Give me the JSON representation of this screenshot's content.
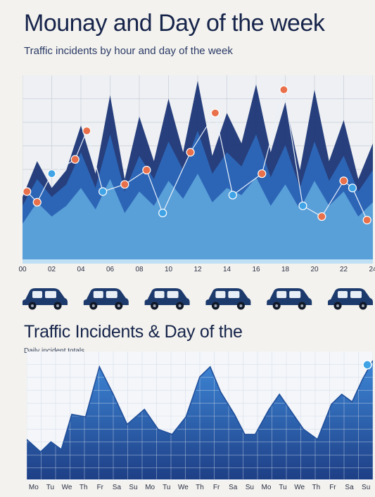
{
  "title": "Mounay and Day of the week",
  "subtitle": "Traffic incidents by hour and day of the week",
  "chart_data": [
    {
      "type": "area",
      "title": "Mounay and Day of the week",
      "subtitle": "Traffic incidents by hour and day of the week",
      "x_tick_labels": [
        "00",
        "02",
        "04",
        "06",
        "08",
        "10",
        "12",
        "14",
        "16",
        "18",
        "20",
        "22",
        "24"
      ],
      "ylim": [
        0,
        100
      ],
      "peak_series": [
        {
          "name": "",
          "color": "#1b3576",
          "values": [
            35,
            55,
            40,
            50,
            75,
            48,
            92,
            45,
            80,
            55,
            90,
            60,
            100,
            58,
            82,
            65,
            98,
            60,
            88,
            50,
            95,
            55,
            78,
            45,
            65
          ]
        },
        {
          "name": "",
          "color": "#2e6cc0",
          "values": [
            30,
            45,
            35,
            42,
            60,
            40,
            70,
            38,
            58,
            45,
            66,
            50,
            72,
            48,
            60,
            52,
            70,
            46,
            64,
            40,
            66,
            44,
            58,
            38,
            50
          ]
        },
        {
          "name": "",
          "color": "#62a9de",
          "values": [
            20,
            32,
            24,
            30,
            40,
            28,
            45,
            26,
            38,
            30,
            44,
            34,
            48,
            32,
            40,
            36,
            46,
            30,
            42,
            28,
            44,
            30,
            38,
            24,
            32
          ]
        }
      ],
      "markers": {
        "points": [
          {
            "x": 0.3,
            "y": 38
          },
          {
            "x": 1.0,
            "y": 32
          },
          {
            "x": 2.0,
            "y": 48
          },
          {
            "x": 3.6,
            "y": 56
          },
          {
            "x": 4.4,
            "y": 72
          },
          {
            "x": 5.5,
            "y": 38
          },
          {
            "x": 7.0,
            "y": 42
          },
          {
            "x": 8.5,
            "y": 50
          },
          {
            "x": 9.6,
            "y": 26
          },
          {
            "x": 11.5,
            "y": 60
          },
          {
            "x": 13.2,
            "y": 82
          },
          {
            "x": 14.4,
            "y": 36
          },
          {
            "x": 16.4,
            "y": 48
          },
          {
            "x": 17.9,
            "y": 95
          },
          {
            "x": 19.2,
            "y": 30
          },
          {
            "x": 20.5,
            "y": 24
          },
          {
            "x": 22.0,
            "y": 44
          },
          {
            "x": 22.6,
            "y": 40
          },
          {
            "x": 23.6,
            "y": 22
          }
        ],
        "orange": "#e8704a",
        "blue": "#3fa3e6"
      }
    },
    {
      "type": "area",
      "title": "Traffic Incidents & Day of the",
      "subtitle": "Daily incident totals",
      "x_tick_labels": [
        "Mo",
        "Tu",
        "We",
        "Th",
        "Fr",
        "Sa",
        "Su",
        "Mo",
        "Tu",
        "We",
        "Th",
        "Fr",
        "Sa",
        "Su",
        "Mo",
        "Tu",
        "We",
        "Th",
        "Fr",
        "Sa",
        "Su"
      ],
      "ylim": [
        0,
        100
      ],
      "series": [
        {
          "name": "",
          "color": "#2c6fc2",
          "x": [
            0,
            4,
            7,
            10,
            13,
            17,
            21,
            25,
            29,
            34,
            38,
            42,
            46,
            50,
            53,
            56,
            60,
            63,
            66,
            70,
            73,
            77,
            80,
            84,
            88,
            91,
            94,
            97,
            100
          ],
          "values": [
            32,
            22,
            30,
            24,
            52,
            50,
            90,
            68,
            44,
            56,
            40,
            36,
            50,
            82,
            90,
            70,
            52,
            36,
            36,
            56,
            68,
            52,
            40,
            32,
            60,
            68,
            62,
            80,
            95
          ]
        }
      ]
    }
  ],
  "cars": {
    "count": 6,
    "color": "#1d3a6d",
    "icon": "car-icon"
  }
}
